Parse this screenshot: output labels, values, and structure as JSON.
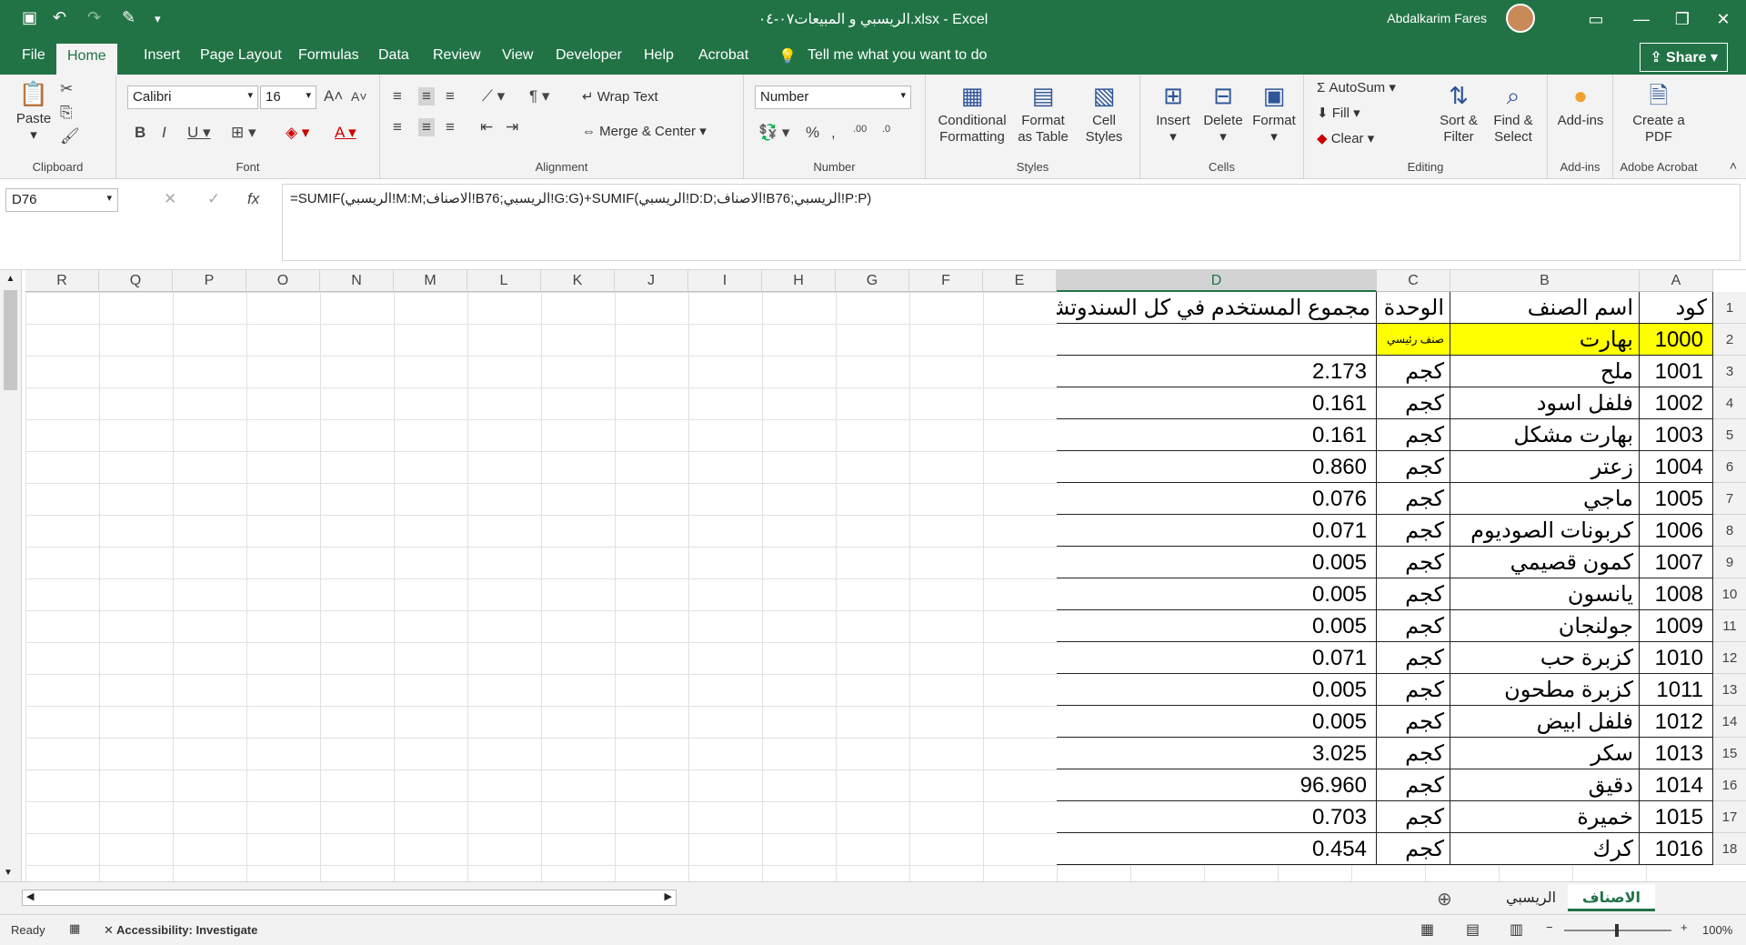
{
  "titlebar": {
    "title": "الريسبي و المبيعات٠٧-٠٤.xlsx  -  Excel",
    "user": "Abdalkarim Fares"
  },
  "tabs": [
    "File",
    "Home",
    "Insert",
    "Page Layout",
    "Formulas",
    "Data",
    "Review",
    "View",
    "Developer",
    "Help",
    "Acrobat"
  ],
  "tell_me": "Tell me what you want to do",
  "share": "Share",
  "ribbon": {
    "clipboard": {
      "paste": "Paste",
      "label": "Clipboard"
    },
    "font": {
      "name": "Calibri",
      "size": "16",
      "label": "Font"
    },
    "alignment": {
      "wrap": "Wrap Text",
      "merge": "Merge & Center",
      "label": "Alignment"
    },
    "number": {
      "format": "Number",
      "label": "Number"
    },
    "styles": {
      "conditional": "Conditional Formatting",
      "format_table": "Format as Table",
      "cell_styles": "Cell Styles",
      "label": "Styles"
    },
    "cells": {
      "insert": "Insert",
      "delete": "Delete",
      "format": "Format",
      "label": "Cells"
    },
    "editing": {
      "autosum": "AutoSum",
      "fill": "Fill",
      "clear": "Clear",
      "sort": "Sort & Filter",
      "find": "Find & Select",
      "label": "Editing"
    },
    "addins": {
      "btn": "Add-ins",
      "label": "Add-ins"
    },
    "acrobat": {
      "btn": "Create a PDF",
      "label": "Adobe Acrobat"
    }
  },
  "formula_bar": {
    "name_box": "D76",
    "formula": "=SUMIF(الريسبي!M:M;الاصناف!B76;الريسبي!G:G)+SUMIF(الريسبي!D:D;الاصناف!B76;الريسبي!P:P)"
  },
  "columns": [
    "R",
    "Q",
    "P",
    "O",
    "N",
    "M",
    "L",
    "K",
    "J",
    "I",
    "H",
    "G",
    "F",
    "E",
    "D",
    "C",
    "B",
    "A"
  ],
  "rows": [
    "1",
    "2",
    "3",
    "4",
    "5",
    "6",
    "7",
    "8",
    "9",
    "10",
    "11",
    "12",
    "13",
    "14",
    "15",
    "16",
    "17",
    "18"
  ],
  "headers": {
    "code": "كود",
    "name": "اسم الصنف",
    "unit": "الوحدة",
    "total": "مجموع المستخدم في كل السندوتشات"
  },
  "data_rows": [
    {
      "code": "1000",
      "name": "بهارت",
      "unit": "صنف رئيسي",
      "total": ""
    },
    {
      "code": "1001",
      "name": "ملح",
      "unit": "كجم",
      "total": "2.173"
    },
    {
      "code": "1002",
      "name": "فلفل اسود",
      "unit": "كجم",
      "total": "0.161"
    },
    {
      "code": "1003",
      "name": "بهارت مشكل",
      "unit": "كجم",
      "total": "0.161"
    },
    {
      "code": "1004",
      "name": "زعتر",
      "unit": "كجم",
      "total": "0.860"
    },
    {
      "code": "1005",
      "name": "ماجي",
      "unit": "كجم",
      "total": "0.076"
    },
    {
      "code": "1006",
      "name": "كربونات الصوديوم",
      "unit": "كجم",
      "total": "0.071"
    },
    {
      "code": "1007",
      "name": "كمون قصيمي",
      "unit": "كجم",
      "total": "0.005"
    },
    {
      "code": "1008",
      "name": "يانسون",
      "unit": "كجم",
      "total": "0.005"
    },
    {
      "code": "1009",
      "name": "جولنجان",
      "unit": "كجم",
      "total": "0.005"
    },
    {
      "code": "1010",
      "name": "كزبرة حب",
      "unit": "كجم",
      "total": "0.071"
    },
    {
      "code": "1011",
      "name": "كزبرة مطحون",
      "unit": "كجم",
      "total": "0.005"
    },
    {
      "code": "1012",
      "name": "فلفل ابيض",
      "unit": "كجم",
      "total": "0.005"
    },
    {
      "code": "1013",
      "name": "سكر",
      "unit": "كجم",
      "total": "3.025"
    },
    {
      "code": "1014",
      "name": "دقيق",
      "unit": "كجم",
      "total": "96.960"
    },
    {
      "code": "1015",
      "name": "خميرة",
      "unit": "كجم",
      "total": "0.703"
    },
    {
      "code": "1016",
      "name": "كرك",
      "unit": "كجم",
      "total": "0.454"
    }
  ],
  "sheets": [
    "الاصناف",
    "الريسبي"
  ],
  "status": {
    "ready": "Ready",
    "accessibility": "Accessibility: Investigate",
    "zoom": "100%"
  },
  "colors": {
    "accent": "#217346",
    "highlight": "#ffff00"
  }
}
